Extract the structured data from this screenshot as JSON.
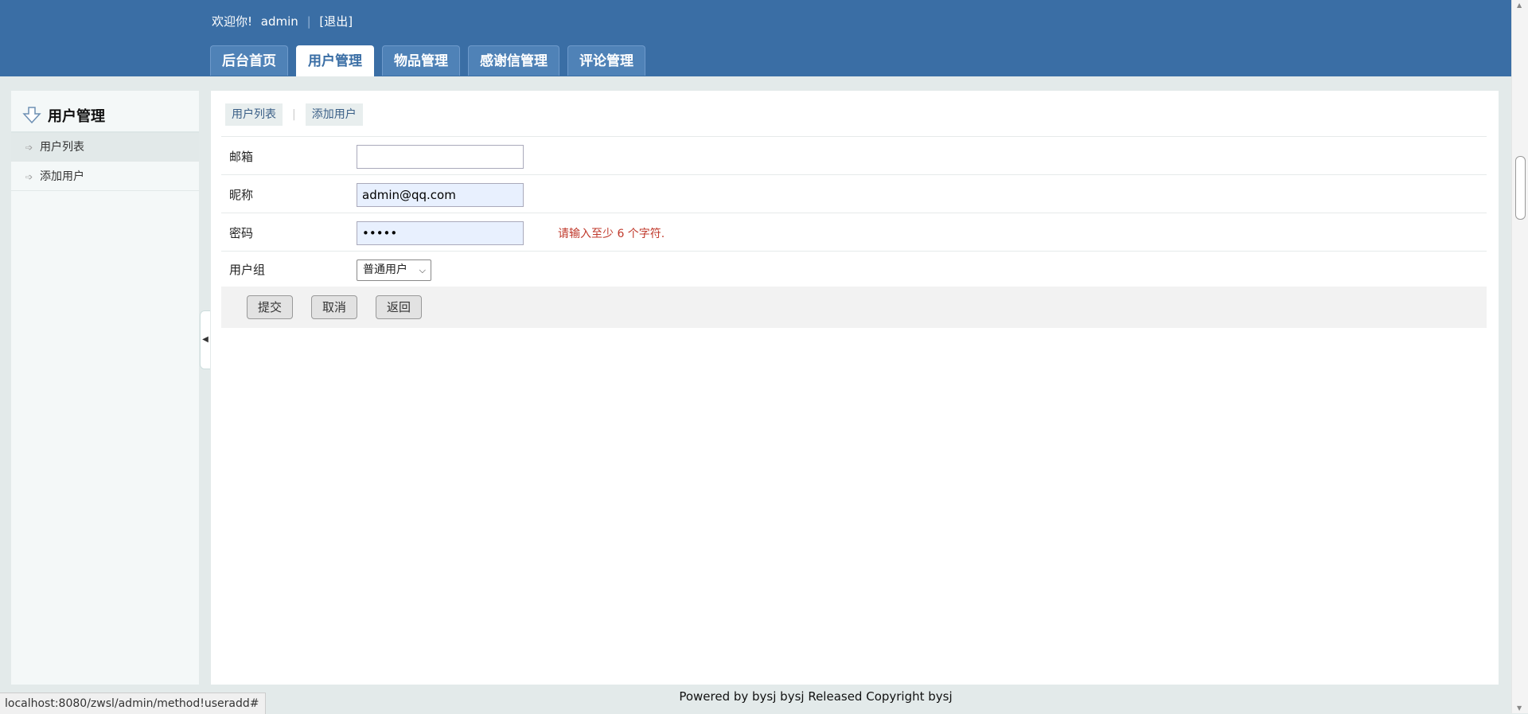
{
  "header": {
    "welcome": "欢迎你!",
    "username": "admin",
    "logout": "[退出]",
    "tabs": [
      "后台首页",
      "用户管理",
      "物品管理",
      "感谢信管理",
      "评论管理"
    ]
  },
  "sidebar": {
    "title": "用户管理",
    "items": [
      "用户列表",
      "添加用户"
    ]
  },
  "main": {
    "subtabs": [
      "用户列表",
      "添加用户"
    ],
    "form": {
      "email_label": "邮箱",
      "email_value": "",
      "nickname_label": "昵称",
      "nickname_value": "admin@qq.com",
      "password_label": "密码",
      "password_value": "•••••",
      "password_error": "请输入至少 6 个字符.",
      "group_label": "用户组",
      "group_value": "普通用户"
    },
    "buttons": {
      "submit": "提交",
      "cancel": "取消",
      "back": "返回"
    }
  },
  "footer": "Powered by bysj bysj Released  Copyright bysj",
  "status_url": "localhost:8080/zwsl/admin/method!useradd#"
}
